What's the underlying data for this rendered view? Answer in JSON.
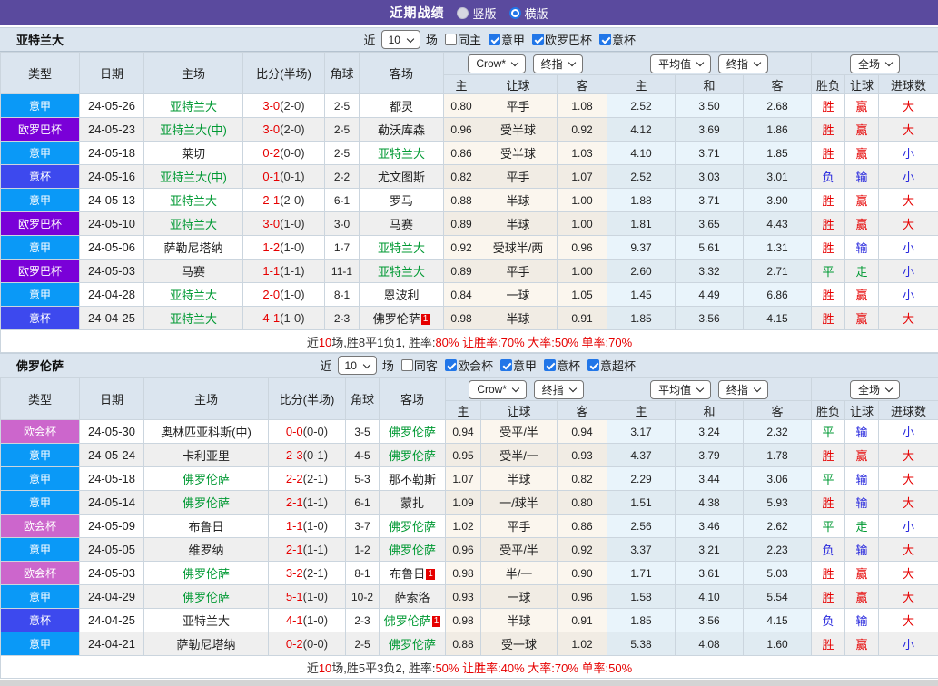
{
  "titlebar": {
    "title": "近期战绩",
    "radio_vertical": "竖版",
    "radio_horizontal": "横版"
  },
  "colors": {
    "league": {
      "意甲": "#0A99F7",
      "欧罗巴杯": "#7A00D8",
      "意杯": "#3D49EE",
      "欧会杯": "#CC66CC"
    },
    "result": {
      "胜": "#E60000",
      "负": "#2727DD",
      "平": "#009933",
      "赢": "#E60000",
      "输": "#2727DD",
      "走": "#009933",
      "大": "#E60000",
      "小": "#2727DD"
    },
    "team_highlight": "#009933",
    "accent_blue": "#2176E8",
    "topbar_purple": "#5A4A9E"
  },
  "common": {
    "near": "近",
    "rounds": "10",
    "matches": "场",
    "dropdowns": {
      "bookmaker": "Crow*",
      "final": "终指",
      "average": "平均值",
      "final2": "终指",
      "scope": "全场"
    },
    "columns": [
      "类型",
      "日期",
      "主场",
      "比分(半场)",
      "角球",
      "客场"
    ],
    "sub_columns": [
      "主",
      "让球",
      "客",
      "主",
      "和",
      "客",
      "胜负",
      "让球",
      "进球数"
    ]
  },
  "tables": [
    {
      "team": "亚特兰大",
      "controls": {
        "same": "同主",
        "leagues": [
          "意甲",
          "欧罗巴杯",
          "意杯"
        ]
      },
      "rows": [
        {
          "league": "意甲",
          "date": "24-05-26",
          "home": "亚特兰大",
          "hg": true,
          "score": "3-0",
          "half": "(2-0)",
          "corner": "2-5",
          "away": "都灵",
          "ag": false,
          "o1": "0.80",
          "h": "平手",
          "o2": "1.08",
          "a1": "2.52",
          "a2": "3.50",
          "a3": "2.68",
          "r1": "胜",
          "r2": "赢",
          "r3": "大"
        },
        {
          "league": "欧罗巴杯",
          "date": "24-05-23",
          "home": "亚特兰大(中)",
          "hg": true,
          "score": "3-0",
          "half": "(2-0)",
          "corner": "2-5",
          "away": "勒沃库森",
          "ag": false,
          "o1": "0.96",
          "h": "受半球",
          "o2": "0.92",
          "a1": "4.12",
          "a2": "3.69",
          "a3": "1.86",
          "r1": "胜",
          "r2": "赢",
          "r3": "大"
        },
        {
          "league": "意甲",
          "date": "24-05-18",
          "home": "莱切",
          "hg": false,
          "score": "0-2",
          "half": "(0-0)",
          "corner": "2-5",
          "away": "亚特兰大",
          "ag": true,
          "o1": "0.86",
          "h": "受半球",
          "o2": "1.03",
          "a1": "4.10",
          "a2": "3.71",
          "a3": "1.85",
          "r1": "胜",
          "r2": "赢",
          "r3": "小"
        },
        {
          "league": "意杯",
          "date": "24-05-16",
          "home": "亚特兰大(中)",
          "hg": true,
          "score": "0-1",
          "half": "(0-1)",
          "corner": "2-2",
          "away": "尤文图斯",
          "ag": false,
          "o1": "0.82",
          "h": "平手",
          "o2": "1.07",
          "a1": "2.52",
          "a2": "3.03",
          "a3": "3.01",
          "r1": "负",
          "r2": "输",
          "r3": "小"
        },
        {
          "league": "意甲",
          "date": "24-05-13",
          "home": "亚特兰大",
          "hg": true,
          "score": "2-1",
          "half": "(2-0)",
          "corner": "6-1",
          "away": "罗马",
          "ag": false,
          "o1": "0.88",
          "h": "半球",
          "o2": "1.00",
          "a1": "1.88",
          "a2": "3.71",
          "a3": "3.90",
          "r1": "胜",
          "r2": "赢",
          "r3": "大"
        },
        {
          "league": "欧罗巴杯",
          "date": "24-05-10",
          "home": "亚特兰大",
          "hg": true,
          "score": "3-0",
          "half": "(1-0)",
          "corner": "3-0",
          "away": "马赛",
          "ag": false,
          "o1": "0.89",
          "h": "半球",
          "o2": "1.00",
          "a1": "1.81",
          "a2": "3.65",
          "a3": "4.43",
          "r1": "胜",
          "r2": "赢",
          "r3": "大"
        },
        {
          "league": "意甲",
          "date": "24-05-06",
          "home": "萨勒尼塔纳",
          "hg": false,
          "score": "1-2",
          "half": "(1-0)",
          "corner": "1-7",
          "away": "亚特兰大",
          "ag": true,
          "o1": "0.92",
          "h": "受球半/两",
          "o2": "0.96",
          "a1": "9.37",
          "a2": "5.61",
          "a3": "1.31",
          "r1": "胜",
          "r2": "输",
          "r3": "小"
        },
        {
          "league": "欧罗巴杯",
          "date": "24-05-03",
          "home": "马赛",
          "hg": false,
          "score": "1-1",
          "half": "(1-1)",
          "corner": "11-1",
          "away": "亚特兰大",
          "ag": true,
          "o1": "0.89",
          "h": "平手",
          "o2": "1.00",
          "a1": "2.60",
          "a2": "3.32",
          "a3": "2.71",
          "r1": "平",
          "r2": "走",
          "r3": "小"
        },
        {
          "league": "意甲",
          "date": "24-04-28",
          "home": "亚特兰大",
          "hg": true,
          "score": "2-0",
          "half": "(1-0)",
          "corner": "8-1",
          "away": "恩波利",
          "ag": false,
          "o1": "0.84",
          "h": "一球",
          "o2": "1.05",
          "a1": "1.45",
          "a2": "4.49",
          "a3": "6.86",
          "r1": "胜",
          "r2": "赢",
          "r3": "小"
        },
        {
          "league": "意杯",
          "date": "24-04-25",
          "home": "亚特兰大",
          "hg": true,
          "score": "4-1",
          "half": "(1-0)",
          "corner": "2-3",
          "away": "佛罗伦萨",
          "ag": false,
          "ab": "1",
          "o1": "0.98",
          "h": "半球",
          "o2": "0.91",
          "a1": "1.85",
          "a2": "3.56",
          "a3": "4.15",
          "r1": "胜",
          "r2": "赢",
          "r3": "大"
        }
      ],
      "footer": [
        {
          "t": "近",
          "c": "k"
        },
        {
          "t": "10",
          "c": "r"
        },
        {
          "t": "场,胜8平1负1, 胜率:",
          "c": "k"
        },
        {
          "t": "80% 让胜率:70% 大率:50% 单率:70%",
          "c": "r"
        }
      ]
    },
    {
      "team": "佛罗伦萨",
      "controls": {
        "same": "同客",
        "leagues": [
          "欧会杯",
          "意甲",
          "意杯",
          "意超杯"
        ]
      },
      "rows": [
        {
          "league": "欧会杯",
          "date": "24-05-30",
          "home": "奥林匹亚科斯(中)",
          "hg": false,
          "score": "0-0",
          "half": "(0-0)",
          "corner": "3-5",
          "away": "佛罗伦萨",
          "ag": true,
          "o1": "0.94",
          "h": "受平/半",
          "o2": "0.94",
          "a1": "3.17",
          "a2": "3.24",
          "a3": "2.32",
          "r1": "平",
          "r2": "输",
          "r3": "小"
        },
        {
          "league": "意甲",
          "date": "24-05-24",
          "home": "卡利亚里",
          "hg": false,
          "score": "2-3",
          "half": "(0-1)",
          "corner": "4-5",
          "away": "佛罗伦萨",
          "ag": true,
          "o1": "0.95",
          "h": "受半/一",
          "o2": "0.93",
          "a1": "4.37",
          "a2": "3.79",
          "a3": "1.78",
          "r1": "胜",
          "r2": "赢",
          "r3": "大"
        },
        {
          "league": "意甲",
          "date": "24-05-18",
          "home": "佛罗伦萨",
          "hg": true,
          "score": "2-2",
          "half": "(2-1)",
          "corner": "5-3",
          "away": "那不勒斯",
          "ag": false,
          "o1": "1.07",
          "h": "半球",
          "o2": "0.82",
          "a1": "2.29",
          "a2": "3.44",
          "a3": "3.06",
          "r1": "平",
          "r2": "输",
          "r3": "大"
        },
        {
          "league": "意甲",
          "date": "24-05-14",
          "home": "佛罗伦萨",
          "hg": true,
          "score": "2-1",
          "half": "(1-1)",
          "corner": "6-1",
          "away": "蒙扎",
          "ag": false,
          "o1": "1.09",
          "h": "一/球半",
          "o2": "0.80",
          "a1": "1.51",
          "a2": "4.38",
          "a3": "5.93",
          "r1": "胜",
          "r2": "输",
          "r3": "大"
        },
        {
          "league": "欧会杯",
          "date": "24-05-09",
          "home": "布鲁日",
          "hg": false,
          "score": "1-1",
          "half": "(1-0)",
          "corner": "3-7",
          "away": "佛罗伦萨",
          "ag": true,
          "o1": "1.02",
          "h": "平手",
          "o2": "0.86",
          "a1": "2.56",
          "a2": "3.46",
          "a3": "2.62",
          "r1": "平",
          "r2": "走",
          "r3": "小"
        },
        {
          "league": "意甲",
          "date": "24-05-05",
          "home": "维罗纳",
          "hg": false,
          "score": "2-1",
          "half": "(1-1)",
          "corner": "1-2",
          "away": "佛罗伦萨",
          "ag": true,
          "o1": "0.96",
          "h": "受平/半",
          "o2": "0.92",
          "a1": "3.37",
          "a2": "3.21",
          "a3": "2.23",
          "r1": "负",
          "r2": "输",
          "r3": "大"
        },
        {
          "league": "欧会杯",
          "date": "24-05-03",
          "home": "佛罗伦萨",
          "hg": true,
          "score": "3-2",
          "half": "(2-1)",
          "corner": "8-1",
          "away": "布鲁日",
          "ag": false,
          "ab": "1",
          "o1": "0.98",
          "h": "半/一",
          "o2": "0.90",
          "a1": "1.71",
          "a2": "3.61",
          "a3": "5.03",
          "r1": "胜",
          "r2": "赢",
          "r3": "大"
        },
        {
          "league": "意甲",
          "date": "24-04-29",
          "home": "佛罗伦萨",
          "hg": true,
          "score": "5-1",
          "half": "(1-0)",
          "corner": "10-2",
          "away": "萨索洛",
          "ag": false,
          "o1": "0.93",
          "h": "一球",
          "o2": "0.96",
          "a1": "1.58",
          "a2": "4.10",
          "a3": "5.54",
          "r1": "胜",
          "r2": "赢",
          "r3": "大"
        },
        {
          "league": "意杯",
          "date": "24-04-25",
          "home": "亚特兰大",
          "hg": false,
          "score": "4-1",
          "half": "(1-0)",
          "corner": "2-3",
          "away": "佛罗伦萨",
          "ag": true,
          "ab": "1",
          "o1": "0.98",
          "h": "半球",
          "o2": "0.91",
          "a1": "1.85",
          "a2": "3.56",
          "a3": "4.15",
          "r1": "负",
          "r2": "输",
          "r3": "大"
        },
        {
          "league": "意甲",
          "date": "24-04-21",
          "home": "萨勒尼塔纳",
          "hg": false,
          "score": "0-2",
          "half": "(0-0)",
          "corner": "2-5",
          "away": "佛罗伦萨",
          "ag": true,
          "o1": "0.88",
          "h": "受一球",
          "o2": "1.02",
          "a1": "5.38",
          "a2": "4.08",
          "a3": "1.60",
          "r1": "胜",
          "r2": "赢",
          "r3": "小"
        }
      ],
      "footer": [
        {
          "t": "近",
          "c": "k"
        },
        {
          "t": "10",
          "c": "r"
        },
        {
          "t": "场,胜5平3负2, 胜率:",
          "c": "k"
        },
        {
          "t": "50% 让胜率:40% 大率:70% 单率:50%",
          "c": "r"
        }
      ]
    }
  ]
}
